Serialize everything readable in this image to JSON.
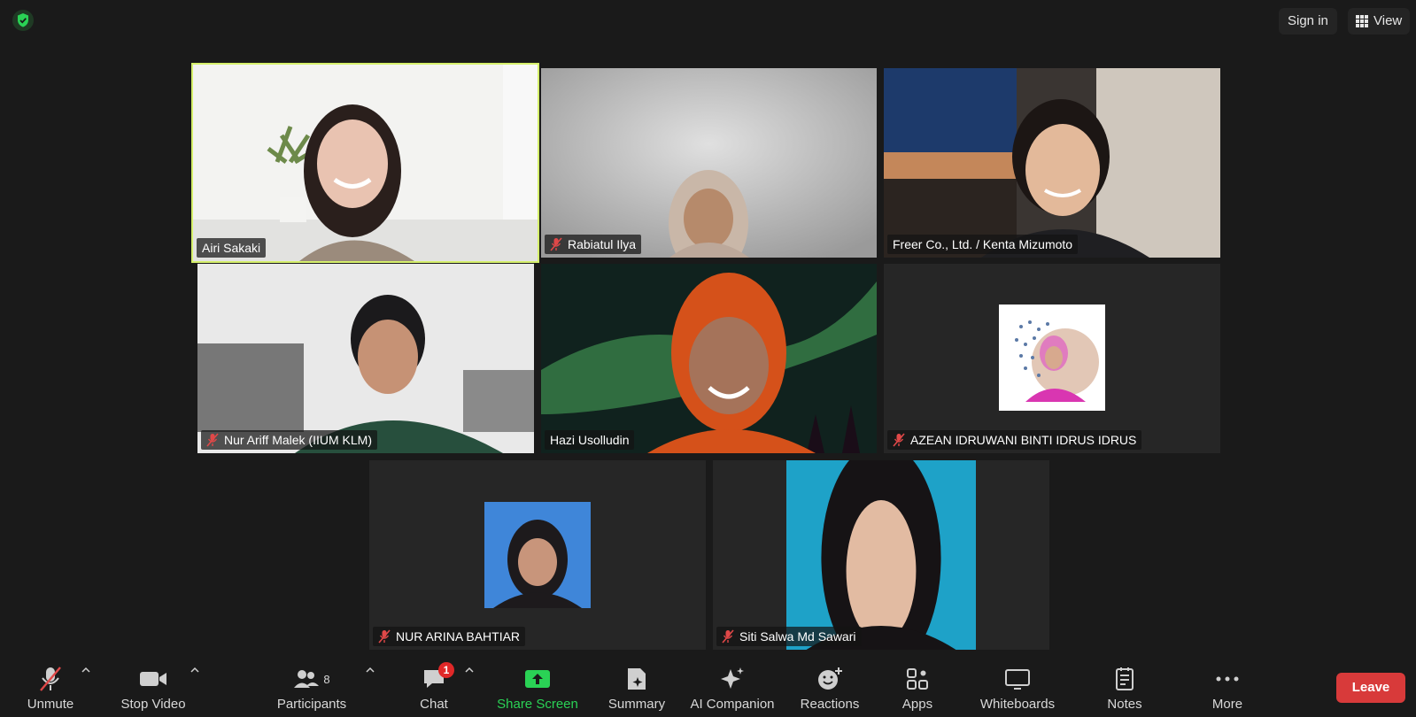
{
  "topbar": {
    "sign_in": "Sign in",
    "view": "View"
  },
  "participants": [
    {
      "name": "Airi Sakaki",
      "muted": false
    },
    {
      "name": "Rabiatul Ilya",
      "muted": true
    },
    {
      "name": "Freer Co., Ltd. / Kenta Mizumoto",
      "muted": false
    },
    {
      "name": "Nur Ariff Malek (IIUM KLM)",
      "muted": true
    },
    {
      "name": "Hazi Usolludin",
      "muted": false
    },
    {
      "name": "AZEAN IDRUWANI BINTI IDRUS IDRUS",
      "muted": true
    },
    {
      "name": "NUR ARINA BAHTIAR",
      "muted": true
    },
    {
      "name": "Siti Salwa Md Sawari",
      "muted": true
    }
  ],
  "toolbar": {
    "unmute": "Unmute",
    "stop_video": "Stop Video",
    "participants": "Participants",
    "participant_count": "8",
    "chat": "Chat",
    "chat_badge": "1",
    "share_screen": "Share Screen",
    "summary": "Summary",
    "ai_companion": "AI Companion",
    "reactions": "Reactions",
    "apps": "Apps",
    "whiteboards": "Whiteboards",
    "notes": "Notes",
    "more": "More",
    "leave": "Leave"
  },
  "colors": {
    "active_speaker": "#d6f06c",
    "share_green": "#2ad255",
    "leave_red": "#d83a3a",
    "mute_red": "#e04848"
  }
}
